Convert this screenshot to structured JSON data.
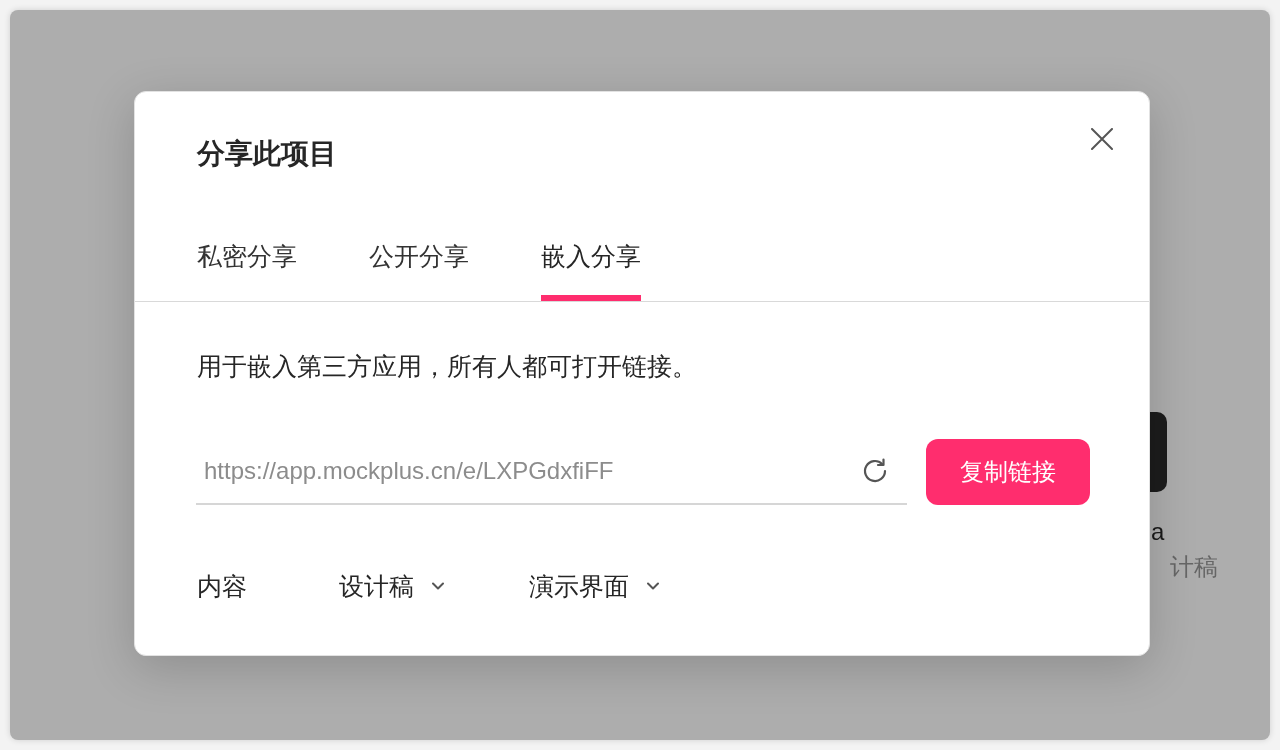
{
  "background": {
    "card": {
      "title": "a",
      "subtitle": "计稿"
    }
  },
  "dialog": {
    "title": "分享此项目",
    "tabs": [
      {
        "label": "私密分享",
        "selected": false
      },
      {
        "label": "公开分享",
        "selected": false
      },
      {
        "label": "嵌入分享",
        "selected": true
      }
    ],
    "description": "用于嵌入第三方应用，所有人都可打开链接。",
    "link_field": {
      "value": "https://app.mockplus.cn/e/LXPGdxfiFF"
    },
    "copy_button": "复制链接",
    "options": [
      {
        "kind": "label",
        "label": "内容"
      },
      {
        "kind": "dropdown",
        "label": "设计稿"
      },
      {
        "kind": "dropdown",
        "label": "演示界面"
      }
    ]
  }
}
